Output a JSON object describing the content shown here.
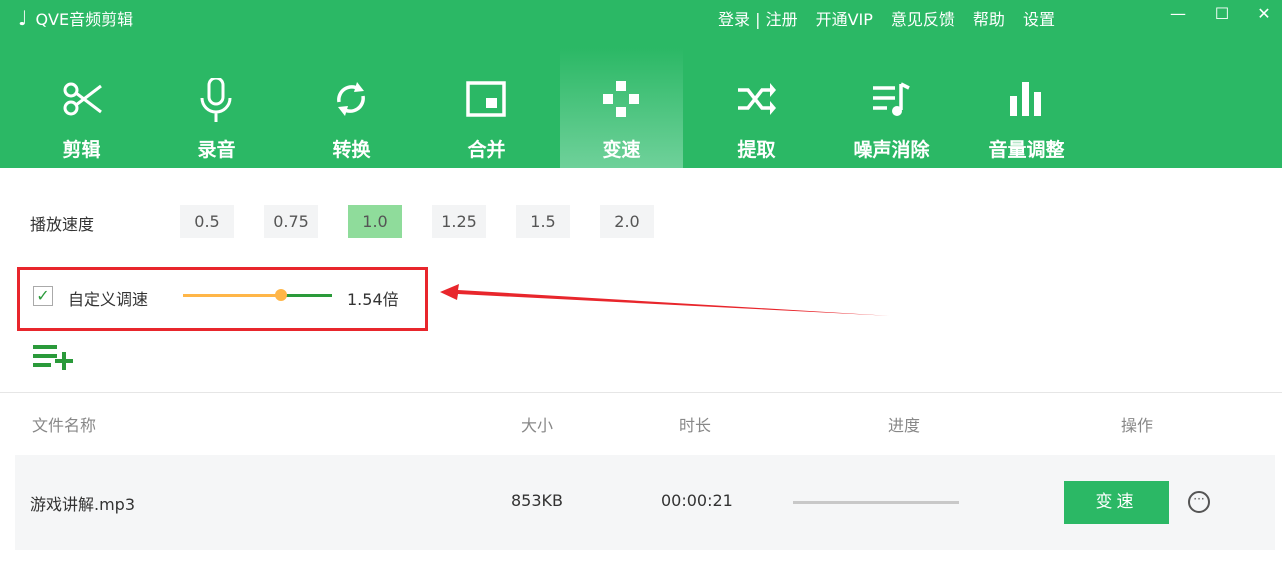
{
  "app": {
    "title": "QVE音频剪辑",
    "links": [
      "登录 | 注册",
      "开通VIP",
      "意见反馈",
      "帮助",
      "设置"
    ]
  },
  "tabs": [
    {
      "label": "剪辑",
      "icon": "scissors-icon"
    },
    {
      "label": "录音",
      "icon": "microphone-icon"
    },
    {
      "label": "转换",
      "icon": "convert-icon"
    },
    {
      "label": "合并",
      "icon": "merge-icon"
    },
    {
      "label": "变速",
      "icon": "gamepad-icon",
      "active": true
    },
    {
      "label": "提取",
      "icon": "shuffle-icon"
    },
    {
      "label": "噪声消除",
      "icon": "noise-icon"
    },
    {
      "label": "音量调整",
      "icon": "volume-bars-icon"
    }
  ],
  "speed": {
    "label": "播放速度",
    "options": [
      "0.5",
      "0.75",
      "1.0",
      "1.25",
      "1.5",
      "2.0"
    ],
    "selected": "1.0"
  },
  "custom": {
    "label": "自定义调速",
    "checked": true,
    "slider_fraction": 0.66,
    "value": "1.54倍"
  },
  "table": {
    "headers": [
      "文件名称",
      "大小",
      "时长",
      "进度",
      "操作"
    ],
    "rows": [
      {
        "name": "游戏讲解.mp3",
        "size": "853KB",
        "duration": "00:00:21",
        "progress": 0,
        "action": "变速"
      }
    ]
  },
  "colors": {
    "brand": "#2bb865",
    "highlight": "#e8262c"
  }
}
